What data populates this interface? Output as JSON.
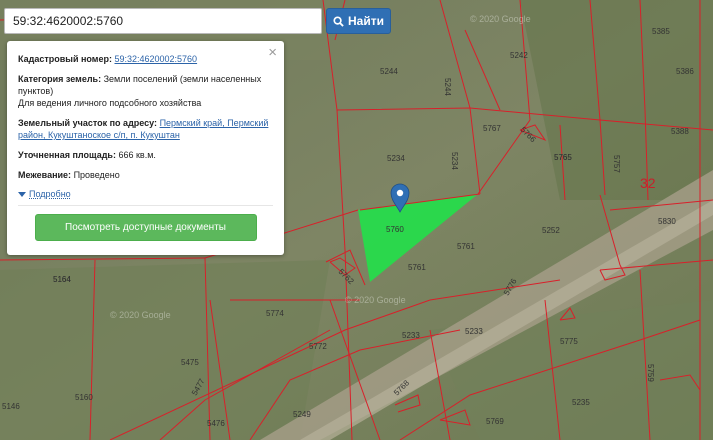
{
  "search": {
    "value": "59:32:4620002:5760",
    "button_label": "Найти"
  },
  "info": {
    "cadastral_label": "Кадастровый номер:",
    "cadastral_value": "59:32:4620002:5760",
    "category_label": "Категория земель:",
    "category_value": "Земли поселений (земли населенных пунктов)",
    "usage_value": "Для ведения личного подсобного хозяйства",
    "address_label": "Земельный участок по адресу:",
    "address_value": "Пермский край, Пермский район, Кукуштаноское с/п, п. Кукуштан",
    "area_label": "Уточненная площадь:",
    "area_value": "666 кв.м.",
    "survey_label": "Межевание:",
    "survey_value": "Проведено",
    "more_label": "Подробно",
    "docs_button": "Посмотреть доступные документы"
  },
  "map": {
    "watermarks": [
      "© 2020 Google",
      "© 2020 Google",
      "© 2020 Google"
    ],
    "block_number": "32",
    "parcels": [
      "5385",
      "5244",
      "5242",
      "5386",
      "5244",
      "5765",
      "5767",
      "5766",
      "5388",
      "5234",
      "5234",
      "5765",
      "5757",
      "5830",
      "5760",
      "5252",
      "5761",
      "5761",
      "5762",
      "5164",
      "5776",
      "5774",
      "5772",
      "5233",
      "5233",
      "5775",
      "5164",
      "5475",
      "5759",
      "5146",
      "5160",
      "5477",
      "5476",
      "5768",
      "5249",
      "5769",
      "5235"
    ]
  },
  "colors": {
    "selected_parcel": "#22e04a",
    "boundary": "#d8202a",
    "marker": "#2f6fb4"
  }
}
